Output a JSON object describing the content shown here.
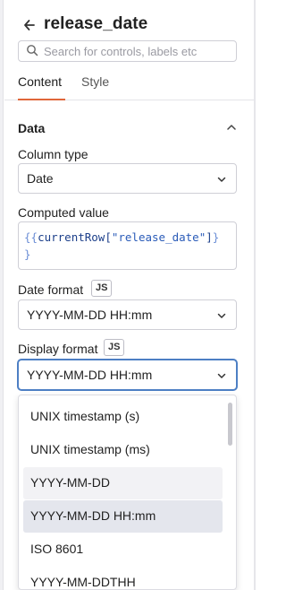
{
  "header": {
    "title": "release_date"
  },
  "search": {
    "placeholder": "Search for controls, labels etc"
  },
  "tabs": [
    {
      "label": "Content",
      "active": true
    },
    {
      "label": "Style",
      "active": false
    }
  ],
  "section": {
    "title": "Data"
  },
  "column_type": {
    "label": "Column type",
    "value": "Date"
  },
  "computed_value": {
    "label": "Computed value",
    "open_brace": "{{",
    "ident": "currentRow",
    "bracket_open": "[",
    "string": "\"release_date\"",
    "bracket_close": "]",
    "close_brace_1": "}",
    "close_brace_2": "}"
  },
  "date_format": {
    "label": "Date format",
    "js": "JS",
    "value": "YYYY-MM-DD HH:mm"
  },
  "display_format": {
    "label": "Display format",
    "js": "JS",
    "value": "YYYY-MM-DD HH:mm"
  },
  "dropdown": {
    "options": [
      "UNIX timestamp (s)",
      "UNIX timestamp (ms)",
      "YYYY-MM-DD",
      "YYYY-MM-DD HH:mm",
      "ISO 8601",
      "YYYY-MM-DDTHH"
    ]
  },
  "colors": {
    "accent": "#e0663a",
    "focus": "#4d7fc4"
  },
  "icons": {
    "back": "arrow-left-icon",
    "search": "search-icon",
    "collapse": "chevron-up-icon",
    "select": "chevron-down-icon"
  }
}
